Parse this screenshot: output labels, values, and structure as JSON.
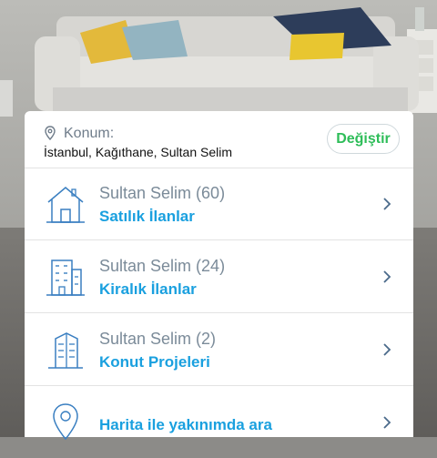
{
  "location": {
    "label": "Konum:",
    "value": "İstanbul, Kağıthane, Sultan Selim",
    "change_label": "Değiştir"
  },
  "menu": [
    {
      "title": "Sultan Selim (60)",
      "subtitle": "Satılık İlanlar",
      "icon": "house-icon"
    },
    {
      "title": "Sultan Selim (24)",
      "subtitle": "Kiralık İlanlar",
      "icon": "apartment-building-icon"
    },
    {
      "title": "Sultan Selim (2)",
      "subtitle": "Konut Projeleri",
      "icon": "project-building-icon"
    },
    {
      "title": "",
      "subtitle": "Harita ile yakınımda ara",
      "icon": "map-pin-icon"
    }
  ],
  "colors": {
    "accent_blue": "#1aa0df",
    "accent_green": "#2ebd59",
    "muted_text": "#7b8b99"
  }
}
